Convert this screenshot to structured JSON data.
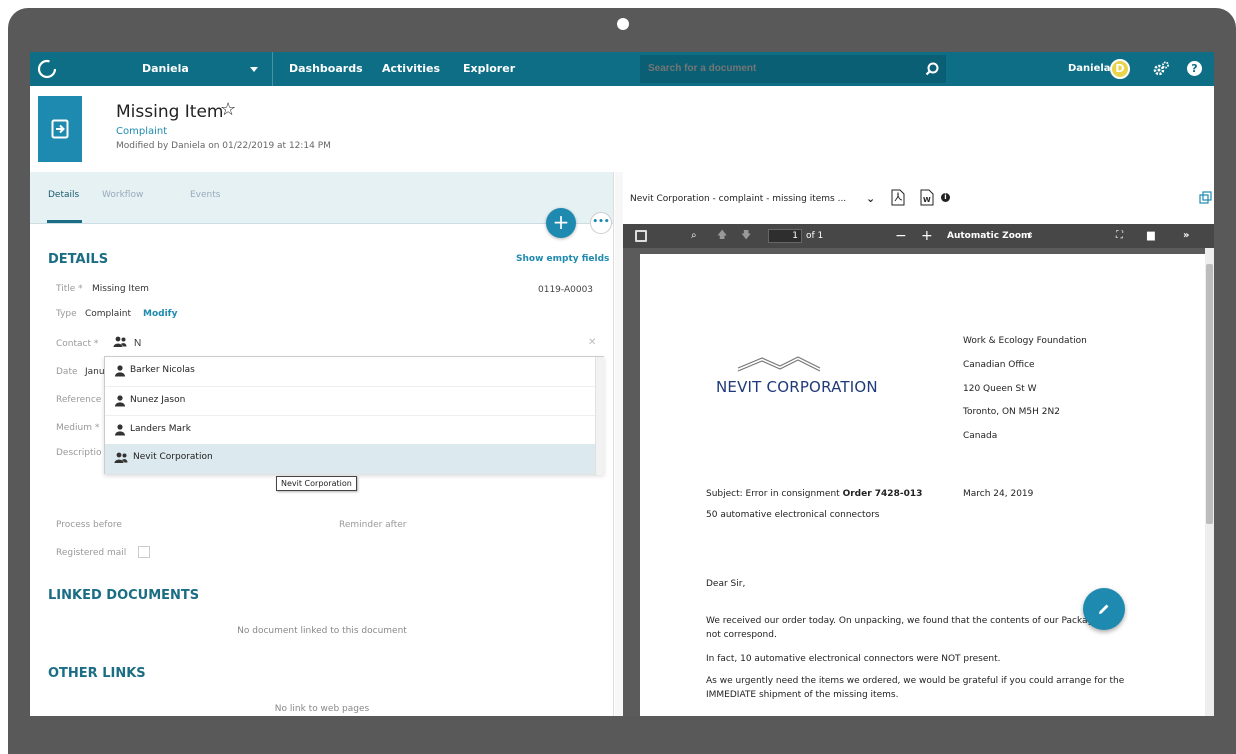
{
  "nav": {
    "user_menu": "Daniela",
    "dashboards": "Dashboards",
    "activities": "Activities",
    "explorer": "Explorer",
    "search_placeholder": "Search for a document",
    "user_name": "Daniela",
    "avatar_initial": "D",
    "help": "?"
  },
  "doc": {
    "title": "Missing Item",
    "type": "Complaint",
    "modified": "Modified by Daniela on 01/22/2019 at 12:14 PM"
  },
  "tabs": [
    "Details",
    "Workflow",
    "Events"
  ],
  "details": {
    "section_title": "DETAILS",
    "show_empty": "Show empty fields",
    "title_label": "Title *",
    "title_value": "Missing Item",
    "doc_number": "0119-A0003",
    "type_label": "Type",
    "type_value": "Complaint",
    "modify": "Modify",
    "contact_label": "Contact *",
    "contact_value": "N",
    "date_label": "Date",
    "date_value": "Janu",
    "reference_label": "Reference",
    "medium_label": "Medium *",
    "description_label": "Descriptio",
    "process_label": "Process before",
    "reminder_label": "Reminder after",
    "registered_label": "Registered mail",
    "registered_checked": false
  },
  "contact_suggestions": [
    {
      "name": "Barker Nicolas",
      "icon": "person-icon"
    },
    {
      "name": "Nunez Jason",
      "icon": "person-icon"
    },
    {
      "name": "Landers Mark",
      "icon": "person-icon"
    },
    {
      "name": "Nevit Corporation",
      "icon": "group-icon"
    }
  ],
  "tooltip": "Nevit Corporation",
  "linked": {
    "title": "LINKED DOCUMENTS",
    "empty": "No document linked to this document"
  },
  "other": {
    "title": "OTHER LINKS",
    "empty": "No link to web pages"
  },
  "viewer": {
    "doc_name": "Nevit Corporation - complaint - missing items ...",
    "page_current": "1",
    "page_total": "of 1",
    "zoom": "Automatic Zoom"
  },
  "letter": {
    "company": "NEVIT CORPORATION",
    "address": [
      "Work & Ecology Foundation",
      "Canadian Office",
      "120 Queen St W",
      "Toronto, ON M5H 2N2",
      "Canada"
    ],
    "subject_prefix": "Subject: Error in consignment ",
    "subject_order": "Order 7428-013",
    "date": "March 24, 2019",
    "items": "50 automative electronical connectors",
    "salutation": "Dear Sir,",
    "para1a": "We received our order today. On unpacking, we found that the contents of our Package did",
    "para1b": "not correspond.",
    "para2": "In fact, 10 automative electronical connectors were NOT present.",
    "para3a": "As we urgently need the items we ordered, we would be grateful if you could arrange for the",
    "para3b": "IMMEDIATE shipment of the missing items."
  },
  "colors": {
    "nav": "#0d6e86",
    "accent": "#1f8aaf",
    "frame": "#595959"
  }
}
